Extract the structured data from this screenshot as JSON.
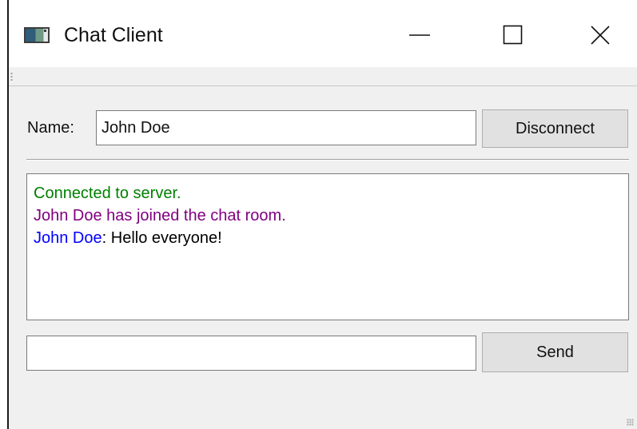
{
  "window": {
    "title": "Chat Client",
    "icon": "app-window-icon",
    "controls": {
      "minimize_icon": "minimize-icon",
      "maximize_icon": "maximize-icon",
      "close_icon": "close-icon"
    }
  },
  "form": {
    "name_label": "Name:",
    "name_value": "John Doe",
    "disconnect_label": "Disconnect",
    "message_value": "",
    "send_label": "Send"
  },
  "chat": {
    "lines": [
      {
        "text": "Connected to server.",
        "color": "#008000"
      },
      {
        "text": "John Doe has joined the chat room.",
        "color": "#800080"
      },
      {
        "sender": "John Doe",
        "sender_color": "#0000ff",
        "separator": ": ",
        "message": "Hello everyone!",
        "color": "#000000"
      }
    ]
  }
}
